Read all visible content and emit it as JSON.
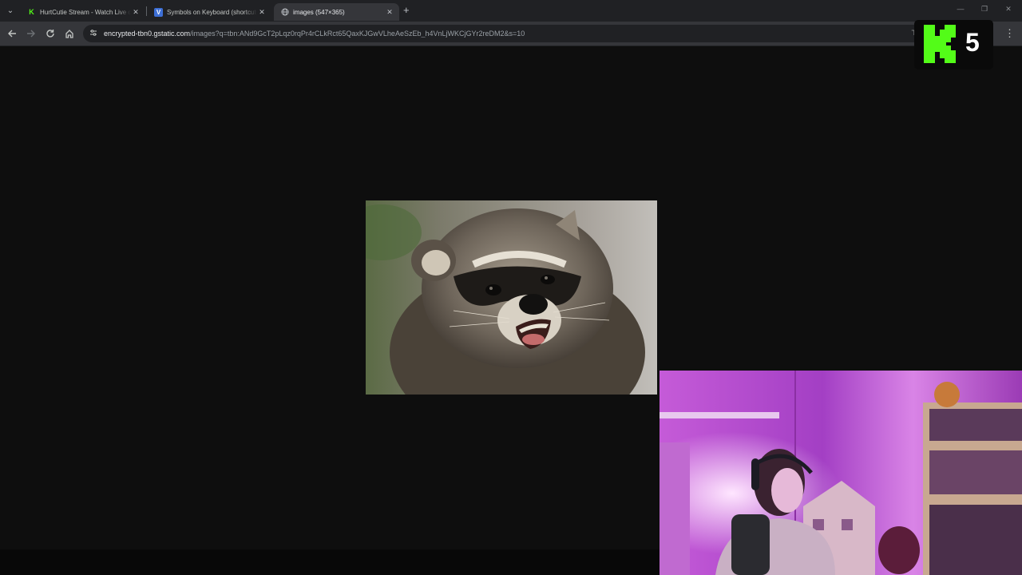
{
  "browser": {
    "tabs": [
      {
        "title": "HurtCutie Stream - Watch Live on Kick",
        "favicon": "kick-icon",
        "active": false
      },
      {
        "title": "Symbols on Keyboard (shortcuts)",
        "favicon": "v-logo-icon",
        "active": false
      },
      {
        "title": "images (547×365)",
        "favicon": "globe-icon",
        "active": true
      }
    ],
    "address_bar": {
      "host": "encrypted-tbn0.gstatic.com",
      "path": "/images?q=tbn:ANd9GcT2pLqz0rqPr4rCLkRct65QaxKJGwVLheAeSzEb_h4VnLjWKCjGYr2reDM2&s=10"
    }
  },
  "overlay": {
    "viewer_count": "5"
  },
  "colors": {
    "kick_green": "#53fc18",
    "page_background": "#0e0e0e",
    "webcam_purple": "#b04ad0"
  }
}
